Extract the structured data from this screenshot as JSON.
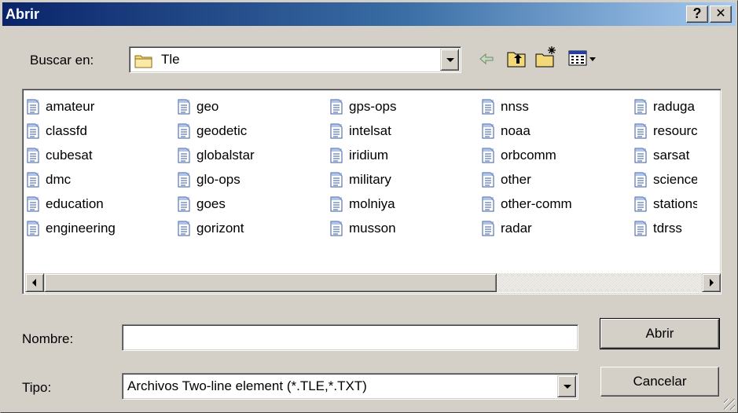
{
  "window": {
    "title": "Abrir",
    "help_label": "?",
    "close_label": "✕"
  },
  "lookin": {
    "label": "Buscar en:",
    "value": "Tle"
  },
  "toolbar": {
    "back_icon": "back-arrow-icon",
    "up_icon": "up-folder-icon",
    "new_folder_icon": "new-folder-icon",
    "view_icon": "view-menu-icon"
  },
  "files": [
    "amateur",
    "classfd",
    "cubesat",
    "dmc",
    "education",
    "engineering",
    "geo",
    "geodetic",
    "globalstar",
    "glo-ops",
    "goes",
    "gorizont",
    "gps-ops",
    "intelsat",
    "iridium",
    "military",
    "molniya",
    "musson",
    "nnss",
    "noaa",
    "orbcomm",
    "other",
    "other-comm",
    "radar",
    "raduga",
    "resource",
    "sarsat",
    "science",
    "stations",
    "tdrss"
  ],
  "filename": {
    "label": "Nombre:",
    "value": ""
  },
  "filetype": {
    "label": "Tipo:",
    "value": "Archivos Two-line element (*.TLE,*.TXT)"
  },
  "buttons": {
    "open": "Abrir",
    "cancel": "Cancelar"
  },
  "colors": {
    "titlebar_start": "#0a246a",
    "titlebar_end": "#a6caf0",
    "face": "#d4d0c8"
  }
}
